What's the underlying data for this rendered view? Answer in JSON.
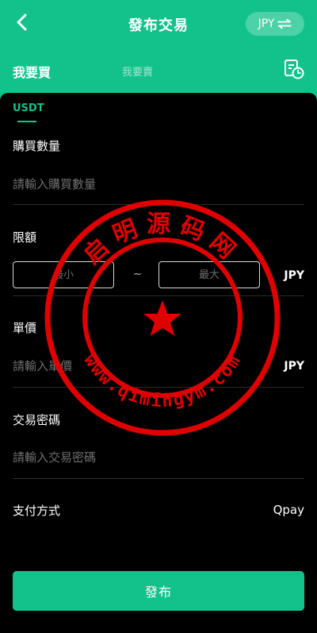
{
  "header": {
    "title": "發布交易",
    "currency": "JPY"
  },
  "tabs": {
    "buy": "我要買",
    "sell": "我要賣"
  },
  "asset_tab": "USDT",
  "form": {
    "quantity": {
      "label": "購買數量",
      "placeholder": "請輸入購買數量"
    },
    "limit": {
      "label": "限額",
      "min_placeholder": "最小",
      "separator": "~",
      "max_placeholder": "最大",
      "unit": "JPY"
    },
    "price": {
      "label": "單價",
      "placeholder": "請輸入單價",
      "unit": "JPY"
    },
    "password": {
      "label": "交易密碼",
      "placeholder": "請輸入交易密碼"
    },
    "payment": {
      "label": "支付方式",
      "value": "Qpay"
    }
  },
  "submit_label": "發布",
  "watermark": {
    "top_text": "启明源码网",
    "bottom_text": "www.qimingym.com",
    "color": "#e00000"
  },
  "colors": {
    "accent": "#12c28a",
    "background": "#000000"
  }
}
